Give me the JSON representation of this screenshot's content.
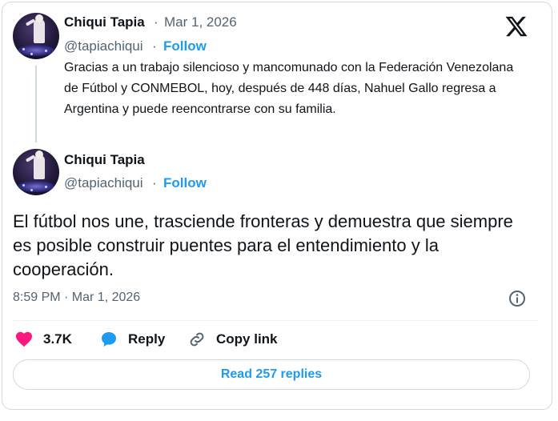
{
  "tweet_parent": {
    "author_name": "Chiqui Tapia",
    "separator": "·",
    "date": "Mar 1, 2026",
    "handle": "@tapiachiqui",
    "handle_separator": "·",
    "follow_label": "Follow",
    "text": "Gracias a un trabajo silencioso y mancomunado con la Federación Venezolana de Fútbol y CONMEBOL, hoy, después de 448 días, Nahuel Gallo regresa a Argentina y puede reencontrarse con su familia."
  },
  "tweet_main": {
    "author_name": "Chiqui Tapia",
    "handle": "@tapiachiqui",
    "handle_separator": "·",
    "follow_label": "Follow",
    "text": "El fútbol nos une, trasciende fronteras y demuestra que siempre es posible construir puentes para el entendimiento y la cooperación.",
    "timestamp": "8:59 PM · Mar 1, 2026"
  },
  "actions": {
    "like_count": "3.7K",
    "reply_label": "Reply",
    "copy_link_label": "Copy link"
  },
  "read_replies_label": "Read 257 replies",
  "colors": {
    "accent": "#1d9bf0",
    "like": "#f91880",
    "muted": "#536471",
    "text": "#0f1419",
    "border": "#cfd9de"
  },
  "icons": [
    "x-logo-icon",
    "info-icon",
    "heart-icon",
    "reply-bubble-icon",
    "link-icon"
  ]
}
